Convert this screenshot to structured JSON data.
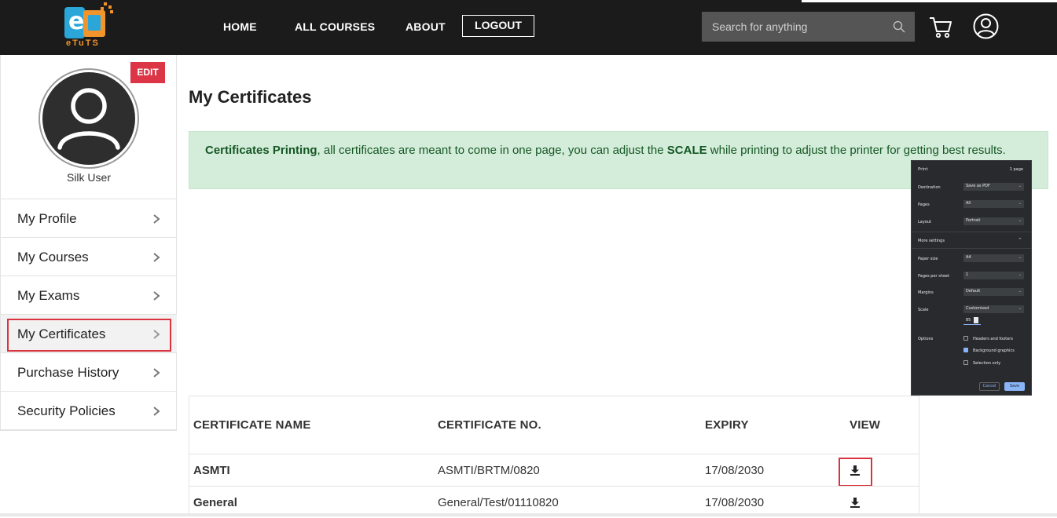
{
  "header": {
    "logo_text": "eTuTS",
    "nav": [
      {
        "label": "HOME"
      },
      {
        "label": "ALL COURSES"
      },
      {
        "label": "ABOUT"
      }
    ],
    "logout_label": "LOGOUT",
    "search_placeholder": "Search for anything",
    "icons": {
      "search": "search-icon",
      "cart": "cart-icon",
      "user": "user-circle-icon"
    }
  },
  "sidebar": {
    "edit_label": "EDIT",
    "user_name": "Silk User",
    "items": [
      {
        "label": "My Profile"
      },
      {
        "label": "My Courses"
      },
      {
        "label": "My Exams"
      },
      {
        "label": "My Certificates",
        "active": true
      },
      {
        "label": "Purchase History"
      },
      {
        "label": "Security Policies"
      }
    ]
  },
  "main": {
    "title": "My Certificates",
    "alert": {
      "bold1": "Certificates Printing",
      "text1": ", all certificates are meant to come in one page, you can adjust the ",
      "bold2": "SCALE",
      "text2": " while printing to adjust the printer for getting best results."
    }
  },
  "print_dialog": {
    "title": "Print",
    "pages_count": "1 page",
    "destination_label": "Destination",
    "destination_value": "Save as PDF",
    "pages_label": "Pages",
    "pages_value": "All",
    "layout_label": "Layout",
    "layout_value": "Portrait",
    "more_settings": "More settings",
    "paper_size_label": "Paper size",
    "paper_size_value": "A4",
    "pages_per_sheet_label": "Pages per sheet",
    "pages_per_sheet_value": "1",
    "margins_label": "Margins",
    "margins_value": "Default",
    "scale_label": "Scale",
    "scale_value": "Customised",
    "scale_number": "85",
    "options_label": "Options",
    "opt_headers": "Headers and footers",
    "opt_background": "Background graphics",
    "opt_selection": "Selection only",
    "cancel": "Cancel",
    "save": "Save"
  },
  "table": {
    "headers": [
      "CERTIFICATE NAME",
      "CERTIFICATE NO.",
      "EXPIRY",
      "VIEW"
    ],
    "rows": [
      {
        "name": "ASMTI",
        "number": "ASMTI/BRTM/0820",
        "expiry": "17/08/2030",
        "view_icon": "download-icon"
      },
      {
        "name": "General",
        "number": "General/Test/01110820",
        "expiry": "17/08/2030",
        "view_icon": "download-icon"
      }
    ]
  },
  "colors": {
    "header_bg": "#1b1b1b",
    "accent_red": "#dc3545",
    "alert_bg": "#d4edda",
    "alert_text": "#155724",
    "logo_blue": "#2aa6d8",
    "logo_orange": "#f0942b"
  }
}
